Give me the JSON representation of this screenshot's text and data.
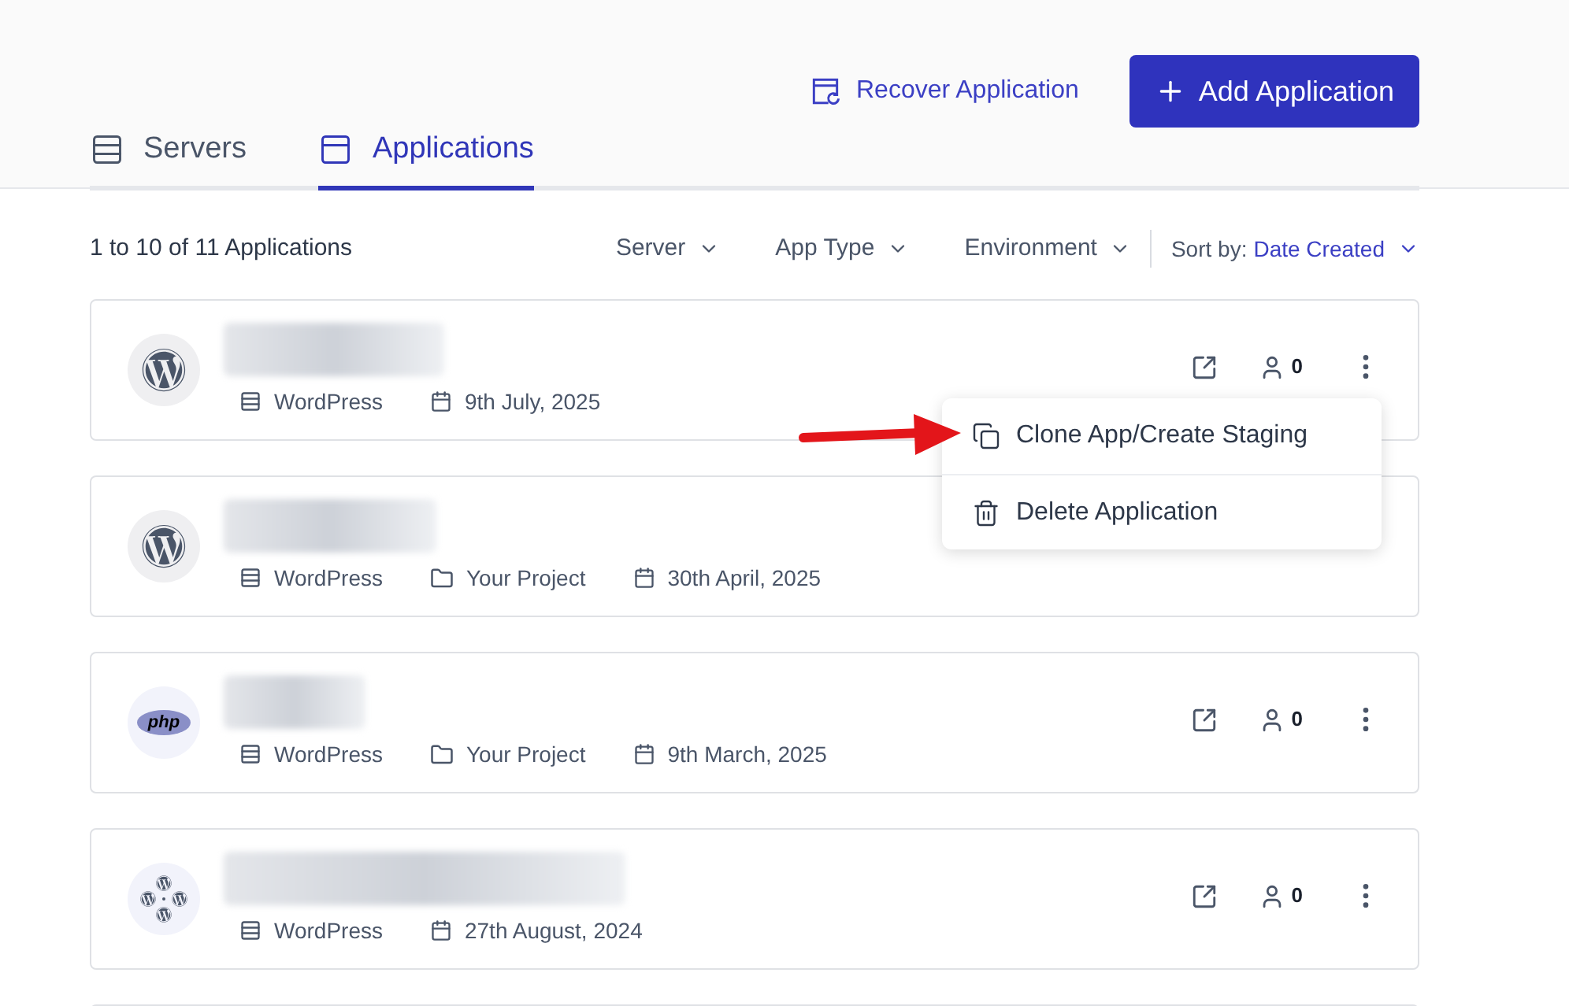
{
  "header": {
    "recover_link": "Recover Application",
    "add_button": "Add Application"
  },
  "tabs": [
    {
      "label": "Servers",
      "kind": "servers",
      "selected": false
    },
    {
      "label": "Applications",
      "kind": "applications",
      "selected": true
    }
  ],
  "toolbar": {
    "count": "1 to 10 of 11 Applications",
    "filters": [
      "Server",
      "App Type",
      "Environment"
    ],
    "sort_label": "Sort by:",
    "sort_value": "Date Created"
  },
  "applications": [
    {
      "kind": "wordpress",
      "type": "WordPress",
      "date": "9th July, 2025",
      "users": "0"
    },
    {
      "kind": "wordpress",
      "type": "WordPress",
      "project": "Your Project",
      "date": "30th April, 2025"
    },
    {
      "kind": "php",
      "logo_text": "php",
      "type": "WordPress",
      "project": "Your Project",
      "date": "9th March, 2025",
      "users": "0"
    },
    {
      "kind": "multisite",
      "type": "WordPress",
      "date": "27th August, 2024",
      "users": "0"
    }
  ],
  "menu": {
    "items": [
      {
        "kind": "clone",
        "label": "Clone App/Create Staging"
      },
      {
        "kind": "delete",
        "label": "Delete Application"
      }
    ]
  }
}
